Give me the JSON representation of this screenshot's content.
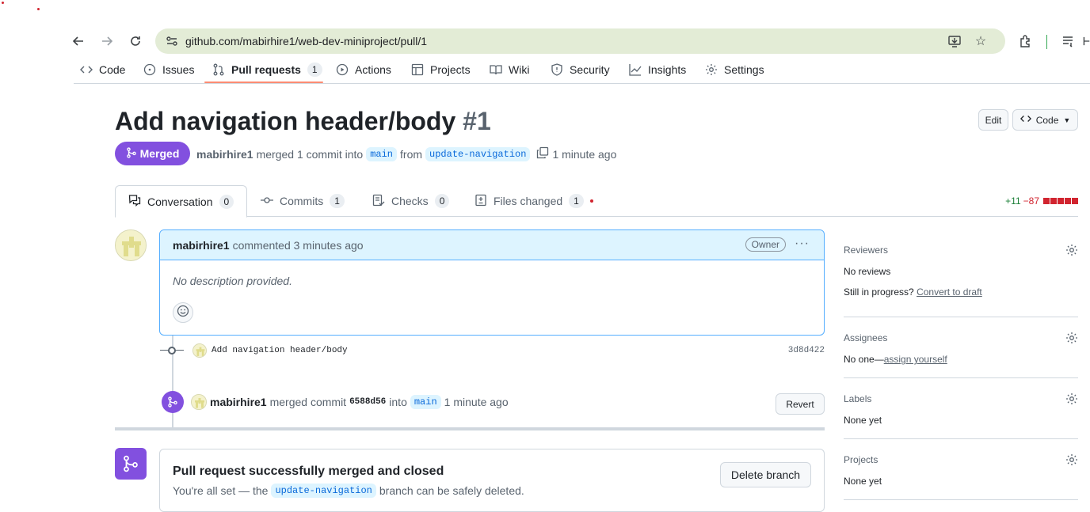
{
  "browser": {
    "url": "github.com/mabirhire1/web-dev-miniproject/pull/1"
  },
  "repo_tabs": [
    {
      "label": "Code",
      "icon": "code-icon"
    },
    {
      "label": "Issues",
      "icon": "issue-icon"
    },
    {
      "label": "Pull requests",
      "icon": "pull-request-icon",
      "count": "1",
      "active": true
    },
    {
      "label": "Actions",
      "icon": "play-icon"
    },
    {
      "label": "Projects",
      "icon": "table-icon"
    },
    {
      "label": "Wiki",
      "icon": "book-icon"
    },
    {
      "label": "Security",
      "icon": "shield-icon"
    },
    {
      "label": "Insights",
      "icon": "graph-icon"
    },
    {
      "label": "Settings",
      "icon": "gear-icon"
    }
  ],
  "pr": {
    "title": "Add navigation header/body",
    "number": "#1",
    "edit_label": "Edit",
    "code_label": "Code",
    "status": "Merged",
    "author": "mabirhire1",
    "merged_text": "merged 1 commit into",
    "base_branch": "main",
    "from_text": "from",
    "head_branch": "update-navigation",
    "time": "1 minute ago"
  },
  "pr_tabs": [
    {
      "label": "Conversation",
      "count": "0"
    },
    {
      "label": "Commits",
      "count": "1"
    },
    {
      "label": "Checks",
      "count": "0"
    },
    {
      "label": "Files changed",
      "count": "1"
    }
  ],
  "diffstat": {
    "additions": "+11",
    "deletions": "−87",
    "added_boxes": 0,
    "deleted_boxes": 5
  },
  "comment": {
    "author": "mabirhire1",
    "action": "commented 3 minutes ago",
    "badge": "Owner",
    "body": "No description provided."
  },
  "commit": {
    "message": "Add navigation header/body",
    "sha": "3d8d422"
  },
  "merge_event": {
    "author": "mabirhire1",
    "text1": "merged commit",
    "sha": "6588d56",
    "text2": "into",
    "branch": "main",
    "time": "1 minute ago",
    "revert_label": "Revert"
  },
  "merge_box": {
    "title": "Pull request successfully merged and closed",
    "text1": "You're all set — the",
    "branch": "update-navigation",
    "text2": "branch can be safely deleted.",
    "delete_label": "Delete branch"
  },
  "sidebar": {
    "reviewers": {
      "heading": "Reviewers",
      "value": "No reviews",
      "draft_prefix": "Still in progress?",
      "draft_link": "Convert to draft"
    },
    "assignees": {
      "heading": "Assignees",
      "value": "No one—",
      "link": "assign yourself"
    },
    "labels": {
      "heading": "Labels",
      "value": "None yet"
    },
    "projects": {
      "heading": "Projects",
      "value": "None yet"
    }
  }
}
